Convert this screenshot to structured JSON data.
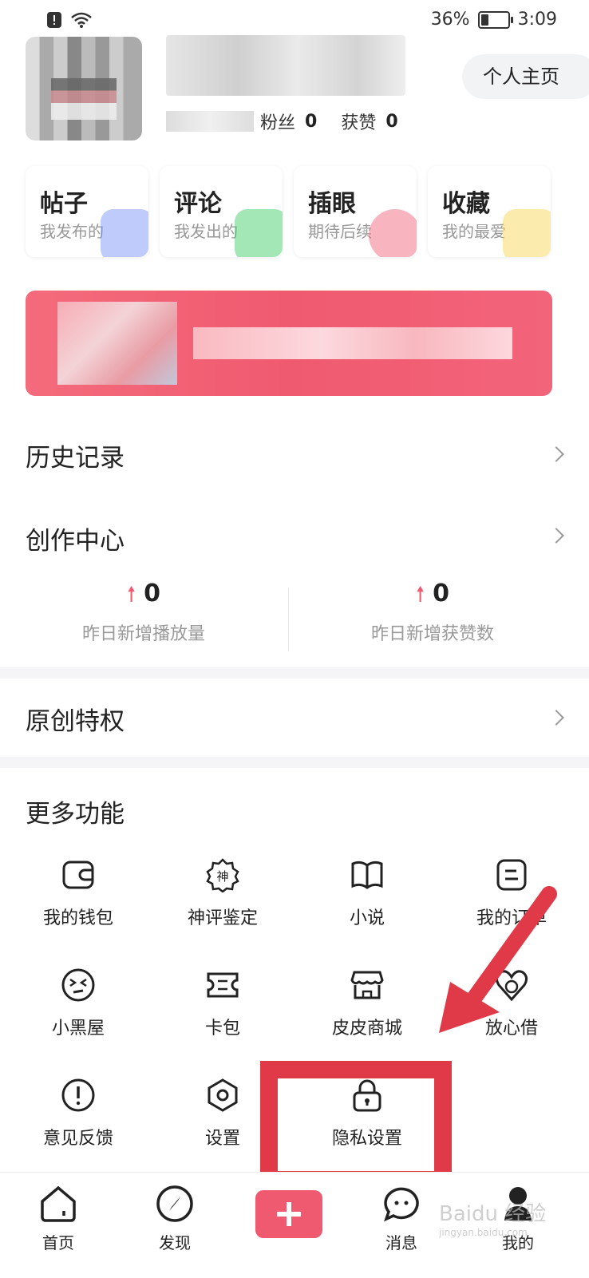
{
  "status_bar": {
    "battery": "36%",
    "time": "3:09",
    "battery_level": 0.36
  },
  "profile": {
    "followers_label": "粉丝",
    "followers": "0",
    "likes_label": "获赞",
    "likes": "0",
    "home_button": "个人主页"
  },
  "cards": [
    {
      "title": "帖子",
      "subtitle": "我发布的",
      "color": "#6e8cf7"
    },
    {
      "title": "评论",
      "subtitle": "我发出的",
      "color": "#35c95e"
    },
    {
      "title": "插眼",
      "subtitle": "期待后续",
      "color": "#f05a70"
    },
    {
      "title": "收藏",
      "subtitle": "我的最爱",
      "color": "#f7d24a"
    }
  ],
  "rows": {
    "history": "历史记录",
    "creation": "创作中心",
    "original": "原创特权",
    "more": "更多功能"
  },
  "metrics": [
    {
      "value": "0",
      "label": "昨日新增播放量"
    },
    {
      "value": "0",
      "label": "昨日新增获赞数"
    }
  ],
  "features": [
    {
      "label": "我的钱包",
      "icon": "wallet-icon"
    },
    {
      "label": "神评鉴定",
      "icon": "shen-badge-icon"
    },
    {
      "label": "小说",
      "icon": "book-icon"
    },
    {
      "label": "我的订单",
      "icon": "order-icon"
    },
    {
      "label": "小黑屋",
      "icon": "dizzy-face-icon"
    },
    {
      "label": "卡包",
      "icon": "card-pack-icon"
    },
    {
      "label": "皮皮商城",
      "icon": "store-icon"
    },
    {
      "label": "放心借",
      "icon": "loan-icon"
    },
    {
      "label": "意见反馈",
      "icon": "exclamation-icon"
    },
    {
      "label": "设置",
      "icon": "settings-hexagon-icon"
    },
    {
      "label": "隐私设置",
      "icon": "lock-icon"
    }
  ],
  "tabs": [
    {
      "label": "首页"
    },
    {
      "label": "发现"
    },
    {
      "label": "消息"
    },
    {
      "label": "我的"
    }
  ],
  "accent": "#f05a70",
  "annotation_color": "#e03a48"
}
